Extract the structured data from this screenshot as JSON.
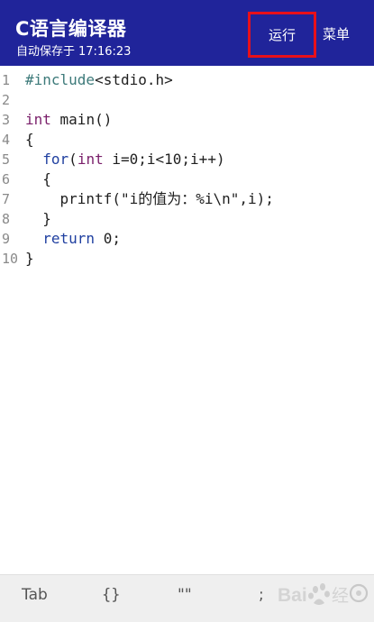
{
  "app_bar": {
    "title": "C语言编译器",
    "subtitle_label": "自动保存于",
    "save_time": "17:16:23",
    "run_label": "运行",
    "menu_label": "菜单"
  },
  "editor": {
    "lines": [
      {
        "num": "1",
        "parts": [
          {
            "t": "#include",
            "c": "pp"
          },
          {
            "t": "<stdio.h>",
            "c": ""
          }
        ]
      },
      {
        "num": "2",
        "parts": []
      },
      {
        "num": "3",
        "parts": [
          {
            "t": "int",
            "c": "kw"
          },
          {
            "t": " main()",
            "c": ""
          }
        ]
      },
      {
        "num": "4",
        "parts": [
          {
            "t": "{",
            "c": ""
          }
        ]
      },
      {
        "num": "5",
        "parts": [
          {
            "t": "  ",
            "c": ""
          },
          {
            "t": "for",
            "c": "kw2"
          },
          {
            "t": "(",
            "c": ""
          },
          {
            "t": "int",
            "c": "kw"
          },
          {
            "t": " i=0;i<10;i++)",
            "c": ""
          }
        ]
      },
      {
        "num": "6",
        "parts": [
          {
            "t": "  {",
            "c": ""
          }
        ]
      },
      {
        "num": "7",
        "parts": [
          {
            "t": "    printf(\"i的值为：%i\\n\",i);",
            "c": ""
          }
        ]
      },
      {
        "num": "8",
        "parts": [
          {
            "t": "  }",
            "c": ""
          }
        ]
      },
      {
        "num": "9",
        "parts": [
          {
            "t": "  ",
            "c": ""
          },
          {
            "t": "return",
            "c": "kw2"
          },
          {
            "t": " 0;",
            "c": ""
          }
        ]
      },
      {
        "num": "10",
        "parts": [
          {
            "t": "}",
            "c": ""
          }
        ]
      }
    ]
  },
  "symbol_bar": {
    "tab": "Tab",
    "braces": "{}",
    "quotes": "\"\"",
    "semicolon": ";"
  },
  "colors": {
    "app_bar_bg": "#20249a",
    "highlight_border": "#e8101a",
    "preprocessor": "#3d7a7a",
    "type_keyword": "#7a1f6a",
    "control_keyword": "#1f3fa0"
  },
  "watermark": "Baidu 经验"
}
